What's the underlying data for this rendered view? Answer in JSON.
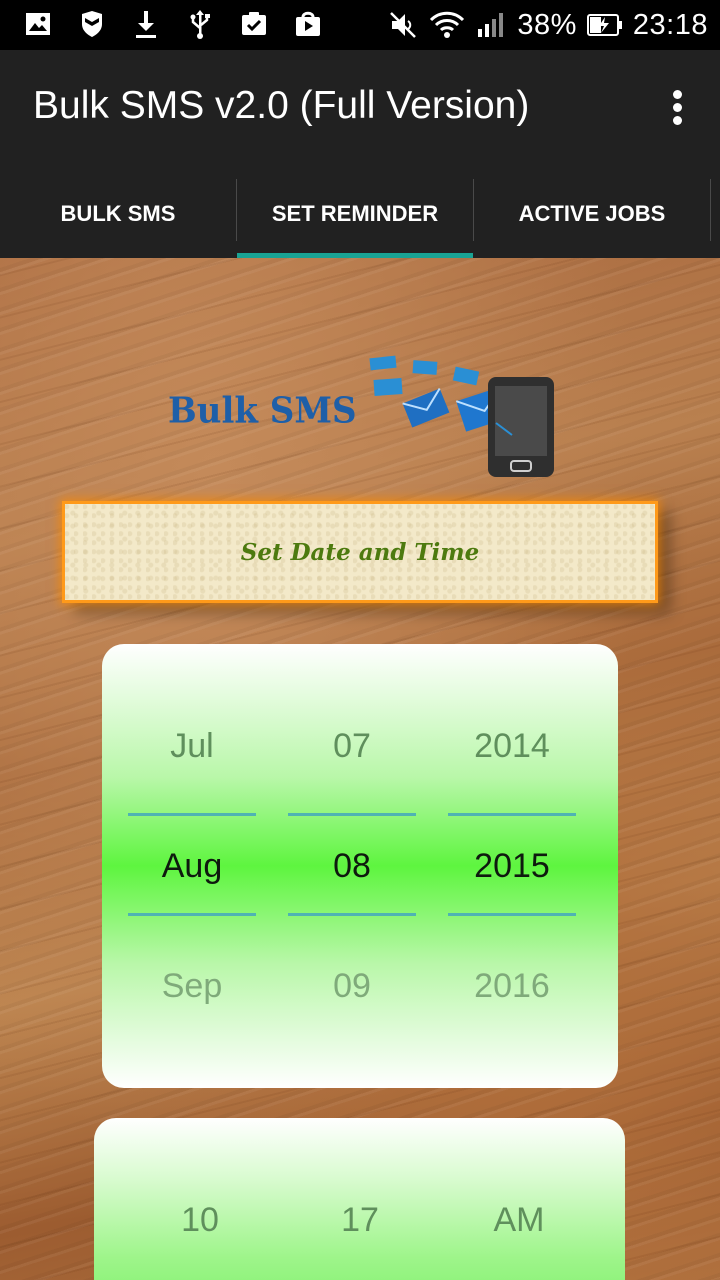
{
  "status_bar": {
    "battery": "38%",
    "time": "23:18",
    "left_icons": [
      "image-icon",
      "shield-icon",
      "download-icon",
      "usb-icon",
      "clipboard-check-icon",
      "play-store-icon"
    ],
    "right_icons": [
      "mute-icon",
      "wifi-icon",
      "signal-icon",
      "battery-icon"
    ]
  },
  "app_bar": {
    "title": "Bulk SMS v2.0 (Full Version)"
  },
  "tabs": [
    {
      "label": "BULK SMS",
      "selected": false
    },
    {
      "label": "SET REMINDER",
      "selected": true
    },
    {
      "label": "ACTIVE JOBS",
      "selected": false
    }
  ],
  "logo": {
    "text": "Bulk SMS"
  },
  "set_button": {
    "label": "Set Date and Time"
  },
  "date_picker": {
    "month": {
      "prev": "Jul",
      "selected": "Aug",
      "next": "Sep"
    },
    "day": {
      "prev": "07",
      "selected": "08",
      "next": "09"
    },
    "year": {
      "prev": "2014",
      "selected": "2015",
      "next": "2016"
    }
  },
  "time_picker": {
    "hour": {
      "prev": "10"
    },
    "minute": {
      "prev": "17"
    },
    "ampm": {
      "prev": "AM"
    }
  },
  "colors": {
    "tab_indicator": "#19a394",
    "app_bar": "#212121",
    "button_border": "#ff9a1a",
    "button_text": "#4d7a0f",
    "picker_green": "#5ef53f",
    "logo_blue": "#1e5fa8"
  }
}
